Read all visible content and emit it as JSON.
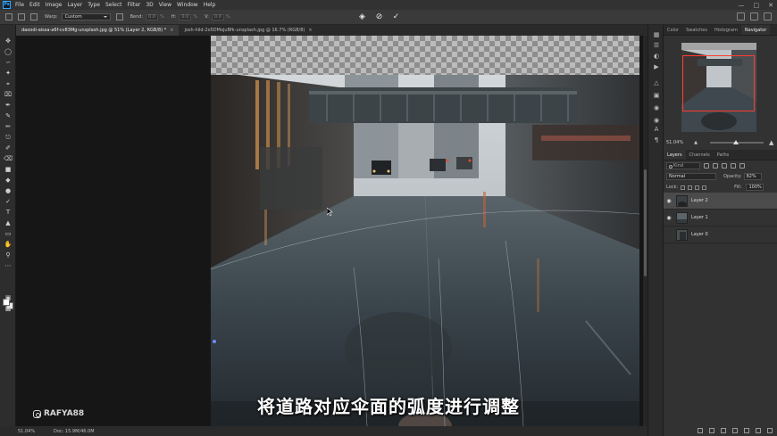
{
  "menu": {
    "logo": "Ps",
    "items": [
      "File",
      "Edit",
      "Image",
      "Layer",
      "Type",
      "Select",
      "Filter",
      "3D",
      "View",
      "Window",
      "Help"
    ]
  },
  "options": {
    "warp_label": "Warp:",
    "warp_value": "Custom",
    "bend_label": "Bend:",
    "bend_value": "0.0",
    "h_label": "H:",
    "h_value": "0.0",
    "v_label": "V:",
    "v_value": "0.0",
    "unit": "%"
  },
  "tabs": [
    {
      "label": "daoodi-aissa-a6f-cv83Mg-unsplash.jpg @ 51% (Layer 2, RGB/8) *",
      "active": true
    },
    {
      "label": "josh-hild-2o5DMojuBfk-unsplash.jpg @ 16.7% (RGB/8)",
      "active": false
    }
  ],
  "status": {
    "zoom": "51.04%",
    "doc": "Doc: 15.9M/46.0M"
  },
  "subtitle": "将道路对应伞面的弧度进行调整",
  "watermark": "RAFYA88",
  "panel": {
    "top_tabs": [
      "Color",
      "Swatches",
      "Histogram",
      "Navigator"
    ],
    "navigator_zoom": "51.04%",
    "layer_tabs": [
      "Layers",
      "Channels",
      "Paths"
    ],
    "kind_placeholder": "Kind",
    "blend_mode": "Normal",
    "opacity_label": "Opacity:",
    "opacity_value": "82%",
    "lock_label": "Lock:",
    "fill_label": "Fill:",
    "fill_value": "100%",
    "layers": [
      {
        "name": "Layer 2",
        "selected": true,
        "visible": true
      },
      {
        "name": "Layer 1",
        "selected": false,
        "visible": true
      },
      {
        "name": "Layer 0",
        "selected": false,
        "visible": false
      }
    ]
  },
  "colors": {
    "accent": "#31a8ff",
    "selection_red": "#ff3b30",
    "warp_line": "#6e8cff"
  }
}
